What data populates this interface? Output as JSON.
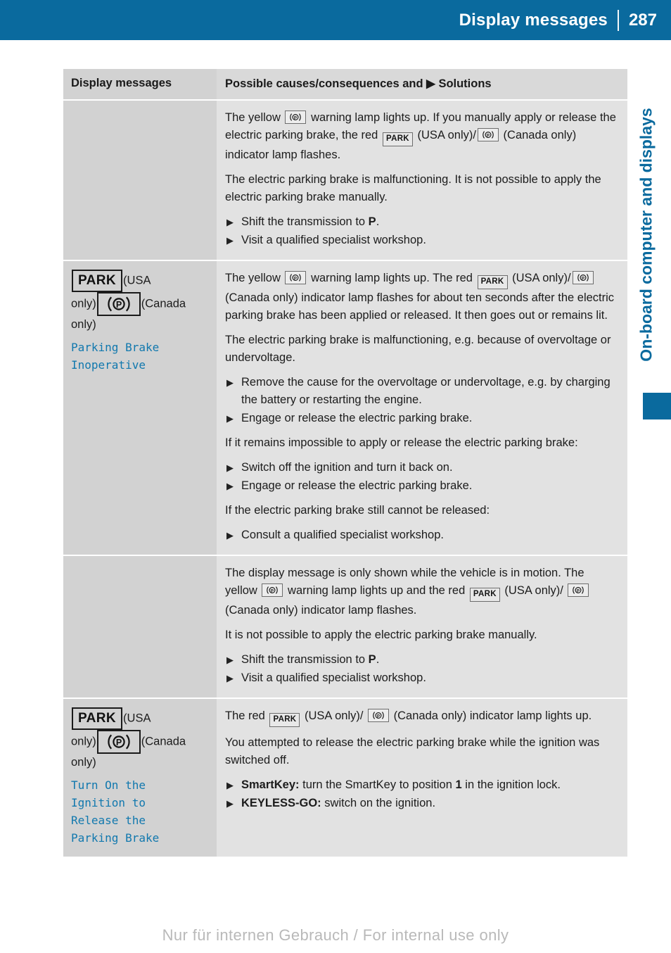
{
  "header": {
    "title": "Display messages",
    "page_number": "287"
  },
  "side_tab": {
    "label": "On-board computer and displays"
  },
  "table": {
    "columns": {
      "left": "Display messages",
      "right_prefix": "Possible causes/consequences and",
      "right_suffix": "Solutions",
      "right_bullet": "▶"
    },
    "rows": [
      {
        "left": {
          "icons": [],
          "suffix_lines": [],
          "message": []
        },
        "right": {
          "paragraphs": [
            "The yellow [P-ICON] warning lamp lights up. If you manually apply or release the electric parking brake, the red [PARK-ICON] (USA only)/[P-ICON] (Canada only) indicator lamp flashes.",
            "The electric parking brake is malfunctioning. It is not possible to apply the electric parking brake manually."
          ],
          "bullets": [
            "Shift the transmission to P.",
            "Visit a qualified specialist workshop."
          ]
        }
      },
      {
        "left": {
          "park_label": "PARK",
          "usa_text": "(USA only)",
          "canada_text": "(Canada only)",
          "message": [
            "Parking Brake",
            "Inoperative"
          ]
        },
        "right": {
          "paragraphs": [
            "The yellow [P-ICON] warning lamp lights up. The red [PARK-ICON] (USA only)/[P-ICON] (Canada only) indicator lamp flashes for about ten seconds after the electric parking brake has been applied or released. It then goes out or remains lit.",
            "The electric parking brake is malfunctioning, e.g. because of overvoltage or undervoltage."
          ],
          "bullets_1": [
            "Remove the cause for the overvoltage or undervoltage, e.g. by charging the battery or restarting the engine.",
            "Engage or release the electric parking brake."
          ],
          "paragraph_2": "If it remains impossible to apply or release the electric parking brake:",
          "bullets_2": [
            "Switch off the ignition and turn it back on.",
            "Engage or release the electric parking brake."
          ],
          "paragraph_3": "If the electric parking brake still cannot be released:",
          "bullets_3": [
            "Consult a qualified specialist workshop."
          ]
        }
      },
      {
        "left": {
          "icons": [],
          "message": []
        },
        "right": {
          "paragraphs": [
            "The display message is only shown while the vehicle is in motion. The yellow [P-ICON] warning lamp lights up and the red [PARK-ICON] (USA only)/ [P-ICON] (Canada only) indicator lamp flashes.",
            "It is not possible to apply the electric parking brake manually."
          ],
          "bullets": [
            "Shift the transmission to P.",
            "Visit a qualified specialist workshop."
          ]
        }
      },
      {
        "left": {
          "park_label": "PARK",
          "usa_text": "(USA only)",
          "canada_text": "(Canada only)",
          "message": [
            "Turn On the",
            "Ignition to",
            "Release the",
            "Parking Brake"
          ]
        },
        "right": {
          "paragraphs": [
            "The red [PARK-ICON] (USA only)/ [P-ICON] (Canada only) indicator lamp lights up.",
            "You attempted to release the electric parking brake while the ignition was switched off."
          ],
          "bullets": [
            "SmartKey: turn the SmartKey to position 1 in the ignition lock.",
            "KEYLESS-GO: switch on the ignition."
          ]
        }
      }
    ]
  },
  "footer": {
    "watermark": "Nur für internen Gebrauch / For internal use only"
  },
  "icons": {
    "brake_lamp": "brake-warning-lamp-icon",
    "park": "park-indicator-icon"
  },
  "colors": {
    "accent_blue": "#0a6a9e",
    "message_blue": "#1178ae",
    "cell_left_bg": "#d2d2d2",
    "cell_right_bg": "#e2e2e2"
  },
  "text_fragments": {
    "r1_p1_a": "The yellow",
    "r1_p1_b": "warning lamp lights up. If you manually apply or release the electric parking brake, the red",
    "r1_p1_c": "(USA only)/",
    "r1_p1_d": "(Canada only) indicator lamp flashes.",
    "r1_p2": "The electric parking brake is malfunctioning. It is not possible to apply the electric parking brake manually.",
    "r1_b1_a": "Shift the transmission to ",
    "r1_b1_b": "P",
    "r1_b1_c": ".",
    "r1_b2": "Visit a qualified specialist workshop.",
    "r2_p1_a": "The yellow",
    "r2_p1_b": "warning lamp lights up. The red",
    "r2_p1_c": "(USA only)/",
    "r2_p1_d": "(Canada only) indicator lamp flashes for about ten seconds after the electric parking brake has been applied or released. It then goes out or remains lit.",
    "r2_p2": "The electric parking brake is malfunctioning, e.g. because of overvoltage or undervoltage.",
    "r2_b1": "Remove the cause for the overvoltage or undervoltage, e.g. by charging the battery or restarting the engine.",
    "r2_b2": "Engage or release the electric parking brake.",
    "r2_p3": "If it remains impossible to apply or release the electric parking brake:",
    "r2_b3": "Switch off the ignition and turn it back on.",
    "r2_b4": "Engage or release the electric parking brake.",
    "r2_p4": "If the electric parking brake still cannot be released:",
    "r2_b5": "Consult a qualified specialist workshop.",
    "r3_p1_a": "The display message is only shown while the vehicle is in motion. The yellow",
    "r3_p1_b": "warning lamp lights up and the red",
    "r3_p1_c": "(USA only)/",
    "r3_p1_d": "(Canada only) indicator lamp flashes.",
    "r3_p2": "It is not possible to apply the electric parking brake manually.",
    "r3_b1_a": "Shift the transmission to ",
    "r3_b1_b": "P",
    "r3_b1_c": ".",
    "r3_b2": "Visit a qualified specialist workshop.",
    "r4_p1_a": "The red",
    "r4_p1_b": "(USA only)/",
    "r4_p1_c": "(Canada only) indicator lamp lights up.",
    "r4_p2": "You attempted to release the electric parking brake while the ignition was switched off.",
    "r4_b1_a": "SmartKey:",
    "r4_b1_b": " turn the SmartKey to position ",
    "r4_b1_c": "1",
    "r4_b1_d": " in the ignition lock.",
    "r4_b2_a": "KEYLESS-GO:",
    "r4_b2_b": " switch on the ignition.",
    "usa_open": "(USA",
    "only_close": "only)",
    "canada_open": "(Canada",
    "only_close2": "only)"
  }
}
